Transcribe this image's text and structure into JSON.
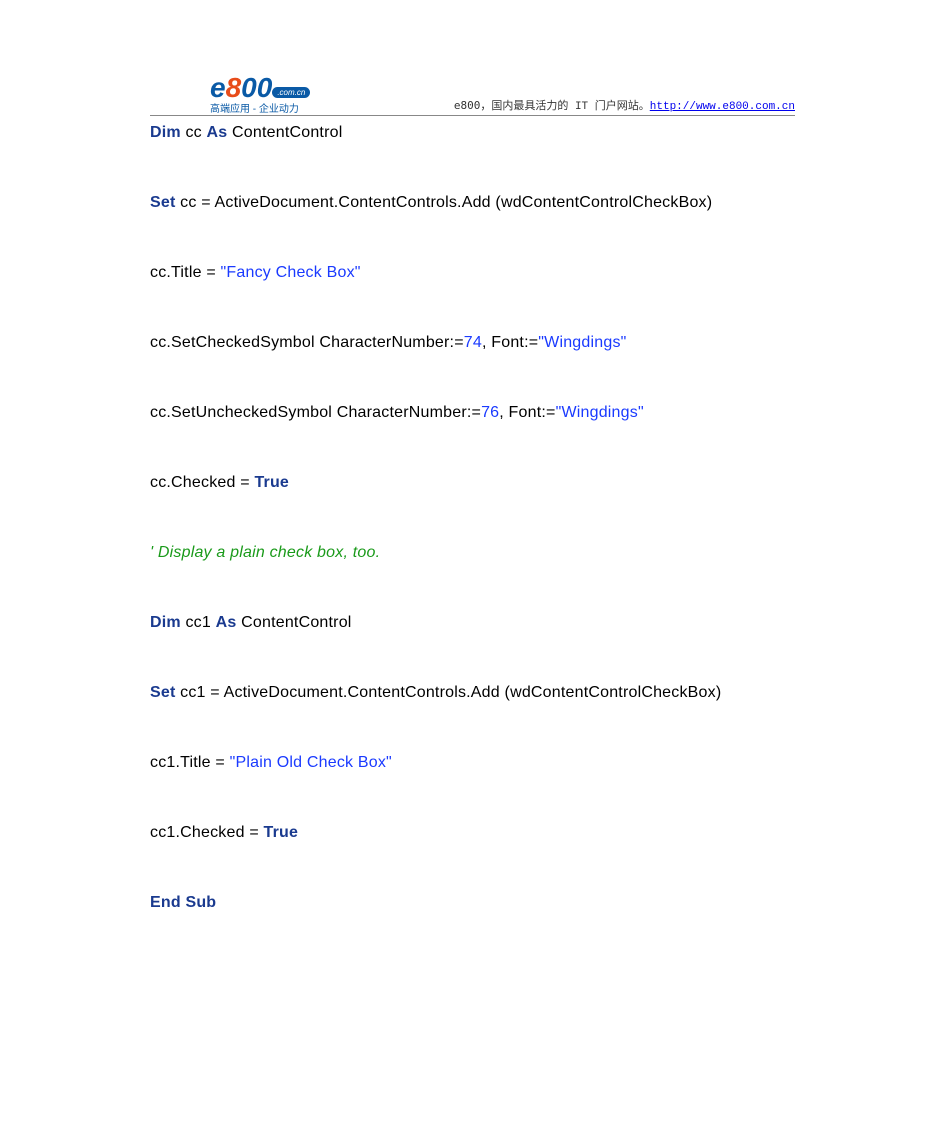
{
  "header": {
    "logo_e": "e",
    "logo_8": "8",
    "logo_00": "00",
    "logo_pill": ".com.cn",
    "logo_sub": "高端应用 - 企业动力",
    "tagline_prefix": "e800，国内最具活力的",
    "tagline_it": " IT ",
    "tagline_suffix": "门户网站。",
    "url": "http://www.e800.com.cn"
  },
  "code": {
    "l1": {
      "kw1": "Dim",
      "t1": " cc ",
      "kw2": "As",
      "t2": " ContentControl"
    },
    "l2": {
      "kw1": "Set",
      "t1": " cc = ActiveDocument.ContentControls.Add",
      "paren_open": " (",
      "arg": "wdContentControlCheckBox",
      "paren_close": ")"
    },
    "l3": {
      "t1": "cc.Title = ",
      "str": "\"Fancy Check Box\""
    },
    "l4": {
      "t1": "cc.SetCheckedSymbol CharacterNumber:=",
      "num1": "74",
      "t2": ", Font:=",
      "str": "\"Wingdings\""
    },
    "l5": {
      "t1": "cc.SetUncheckedSymbol CharacterNumber:=",
      "num1": "76",
      "t2": ", Font:=",
      "str": "\"Wingdings\""
    },
    "l6": {
      "t1": "cc.Checked = ",
      "kw1": "True"
    },
    "l7": {
      "cmt": "' Display a plain check box, too."
    },
    "l8": {
      "kw1": "Dim",
      "t1": " cc1 ",
      "kw2": "As",
      "t2": " ContentControl"
    },
    "l9": {
      "kw1": "Set",
      "t1": " cc1 = ActiveDocument.ContentControls.Add",
      "paren_open": " (",
      "arg": "wdContentControlCheckBox",
      "paren_close": ")"
    },
    "l10": {
      "t1": "cc1.Title = ",
      "str": "\"Plain Old Check Box\""
    },
    "l11": {
      "t1": "cc1.Checked = ",
      "kw1": "True"
    },
    "l12": {
      "kw1": "End Sub"
    }
  }
}
